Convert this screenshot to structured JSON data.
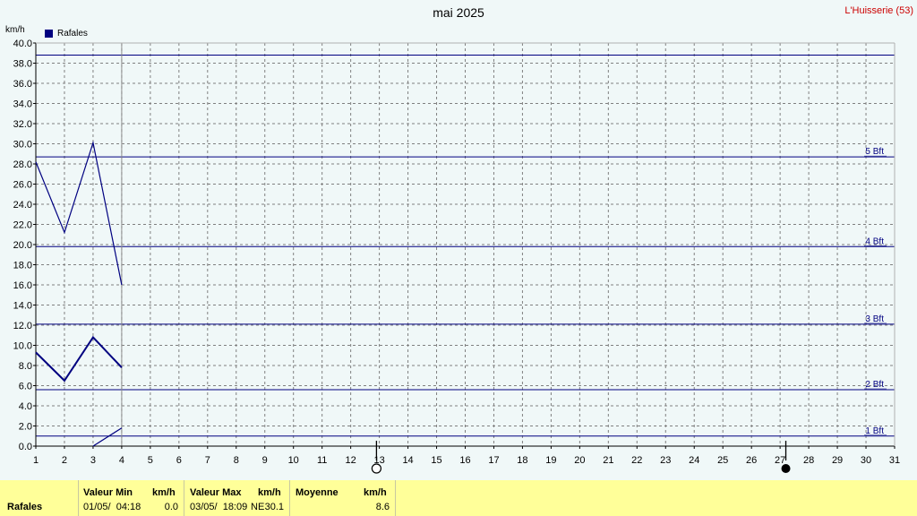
{
  "page": {
    "title": "mai 2025",
    "location": "L'Huisserie (53)",
    "unit": "km/h",
    "legend_label": "Rafales"
  },
  "chart_data": {
    "type": "line",
    "title": "mai 2025",
    "ylabel": "km/h",
    "xlim": [
      1,
      31
    ],
    "ylim": [
      0,
      40
    ],
    "x_ticks": [
      1,
      2,
      3,
      4,
      5,
      6,
      7,
      8,
      9,
      10,
      11,
      12,
      13,
      14,
      15,
      16,
      17,
      18,
      19,
      20,
      21,
      22,
      23,
      24,
      25,
      26,
      27,
      28,
      29,
      30,
      31
    ],
    "y_ticks": [
      "0.0",
      "2.0",
      "4.0",
      "6.0",
      "8.0",
      "10.0",
      "12.0",
      "14.0",
      "16.0",
      "18.0",
      "20.0",
      "22.0",
      "24.0",
      "26.0",
      "28.0",
      "30.0",
      "32.0",
      "34.0",
      "36.0",
      "38.0",
      "40.0"
    ],
    "grid": true,
    "legend": "top-left",
    "series": [
      {
        "name": "Rafales",
        "role": "max",
        "x": [
          1,
          2,
          3,
          4
        ],
        "values": [
          28.2,
          21.2,
          30.1,
          16.0
        ],
        "color": "#000080"
      },
      {
        "role": "mean",
        "x": [
          1,
          2,
          3,
          4
        ],
        "values": [
          9.3,
          6.5,
          10.8,
          7.8
        ],
        "color": "#000080"
      },
      {
        "role": "min",
        "x": [
          3,
          4
        ],
        "values": [
          0.0,
          1.8
        ],
        "color": "#000080"
      }
    ],
    "beaufort_lines": [
      {
        "label": "1 Bft",
        "value": 1.0
      },
      {
        "label": "2 Bft",
        "value": 5.6
      },
      {
        "label": "3 Bft",
        "value": 12.1
      },
      {
        "label": "4 Bft",
        "value": 19.8
      },
      {
        "label": "5 Bft",
        "value": 28.7
      },
      {
        "label": "",
        "value": 38.8
      }
    ],
    "moon_phases": [
      {
        "day": 12.9,
        "phase": "full"
      },
      {
        "day": 27.2,
        "phase": "new"
      }
    ],
    "current_day": 4,
    "colors": {
      "series": "#000080",
      "grid": "#808080",
      "axis": "#000000"
    }
  },
  "footer": {
    "row_label": "Rafales",
    "min_header": "Valeur Min",
    "min_unit": "km/h",
    "min_date": "01/05/  04:18",
    "min_value": "0.0",
    "max_header": "Valeur Max",
    "max_unit": "km/h",
    "max_date": "03/05/  18:09",
    "max_dir": "NE",
    "max_value": "30.1",
    "mean_header": "Moyenne",
    "mean_unit": "km/h",
    "mean_value": "8.6"
  }
}
